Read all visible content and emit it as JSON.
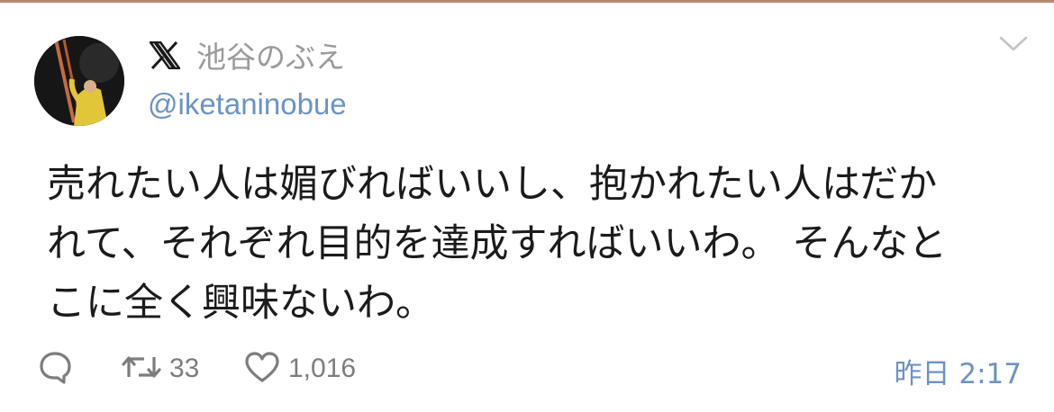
{
  "author": {
    "display_name": "池谷のぶえ",
    "handle": "@iketaninobue",
    "platform_logo": "x-logo-icon"
  },
  "tweet": {
    "lines": [
      "売れたい人は媚びればいいし、抱かれたい人はだか",
      "れて、それぞれ目的を達成すればいいわ。 そんなと",
      "こに全く興味ないわ。"
    ]
  },
  "actions": {
    "reply_icon": "reply-icon",
    "retweet_icon": "retweet-icon",
    "retweet_count": "33",
    "like_icon": "heart-icon",
    "like_count": "1,016"
  },
  "timestamp": "昨日 2:17",
  "colors": {
    "link_blue": "#6c93c4",
    "muted_gray": "#9a9a9a",
    "icon_gray": "#7d7d7d",
    "top_rule": "#b9876f"
  }
}
